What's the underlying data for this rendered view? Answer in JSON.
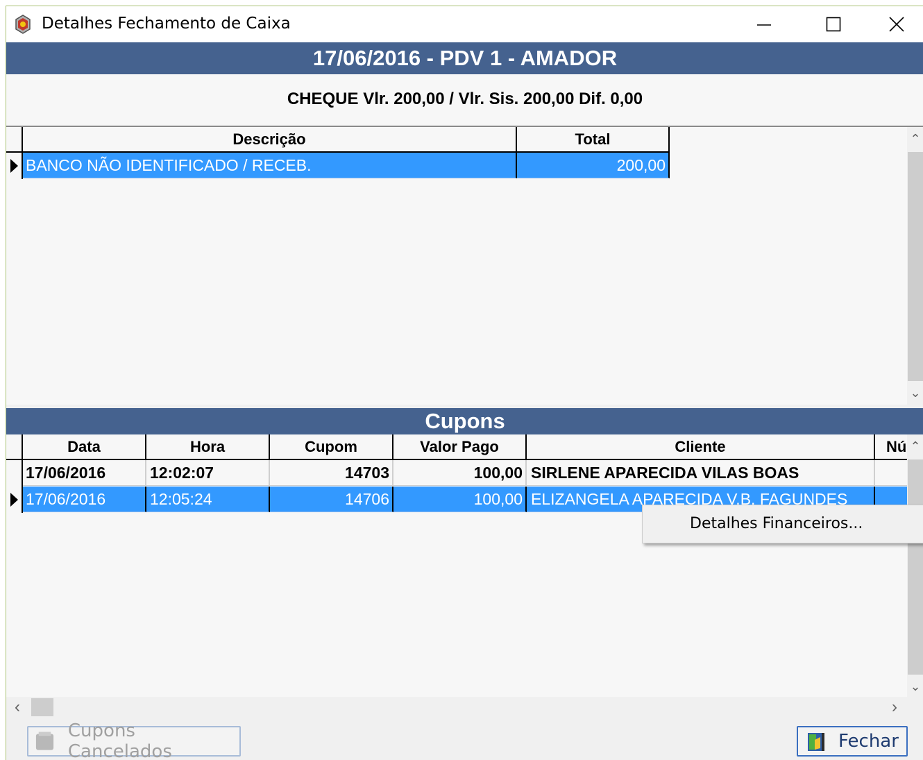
{
  "window": {
    "title": "Detalhes Fechamento de Caixa",
    "minimize_icon": "minimize-icon",
    "maximize_icon": "maximize-icon",
    "close_icon": "close-icon"
  },
  "header": {
    "title": "17/06/2016 - PDV 1 - AMADOR",
    "summary": "CHEQUE Vlr. 200,00 / Vlr. Sis. 200,00 Dif. 0,00"
  },
  "payments_grid": {
    "columns": [
      "Descrição",
      "Total"
    ],
    "rows": [
      {
        "descricao": "BANCO NÃO IDENTIFICADO / RECEB.",
        "total": "200,00",
        "selected": true
      }
    ]
  },
  "cupons": {
    "title": "Cupons",
    "columns": [
      "Data",
      "Hora",
      "Cupom",
      "Valor Pago",
      "Cliente",
      "Nú"
    ],
    "rows": [
      {
        "data": "17/06/2016",
        "hora": "12:02:07",
        "cupom": "14703",
        "valor_pago": "100,00",
        "cliente": "SIRLENE APARECIDA VILAS BOAS",
        "selected": false
      },
      {
        "data": "17/06/2016",
        "hora": "12:05:24",
        "cupom": "14706",
        "valor_pago": "100,00",
        "cliente": "ELIZANGELA APARECIDA V.B. FAGUNDES",
        "selected": true
      }
    ]
  },
  "context_menu": {
    "items": [
      "Detalhes Financeiros..."
    ]
  },
  "buttons": {
    "cancelados": "Cupons Cancelados",
    "fechar": "Fechar"
  },
  "colors": {
    "band": "#45628f",
    "selection": "#3399ff"
  }
}
